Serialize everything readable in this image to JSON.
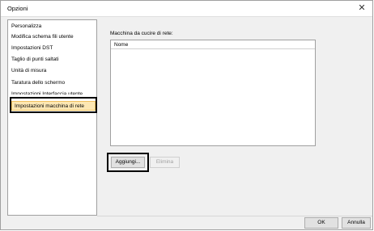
{
  "window": {
    "title": "Opzioni"
  },
  "sidebar": {
    "items": [
      {
        "label": "Personalizza"
      },
      {
        "label": "Modifica schema fili utente"
      },
      {
        "label": "Impostazioni DST"
      },
      {
        "label": "Taglio di punti saltati"
      },
      {
        "label": "Unità di misura"
      },
      {
        "label": "Taratura dello schermo"
      },
      {
        "label": "Impostazioni Interfaccia utente"
      },
      {
        "label": "Impostazioni macchina di rete"
      }
    ],
    "selected_index": 7
  },
  "main": {
    "section_label": "Macchina da cucire di rete:",
    "list": {
      "columns": [
        "Nome"
      ],
      "rows": []
    },
    "add_button": "Aggiungi...",
    "delete_button": "Elimina"
  },
  "footer": {
    "ok_button": "OK",
    "cancel_button": "Annulla"
  },
  "colors": {
    "selection_bg": "#fde7b3",
    "selection_border": "#f0c060"
  }
}
